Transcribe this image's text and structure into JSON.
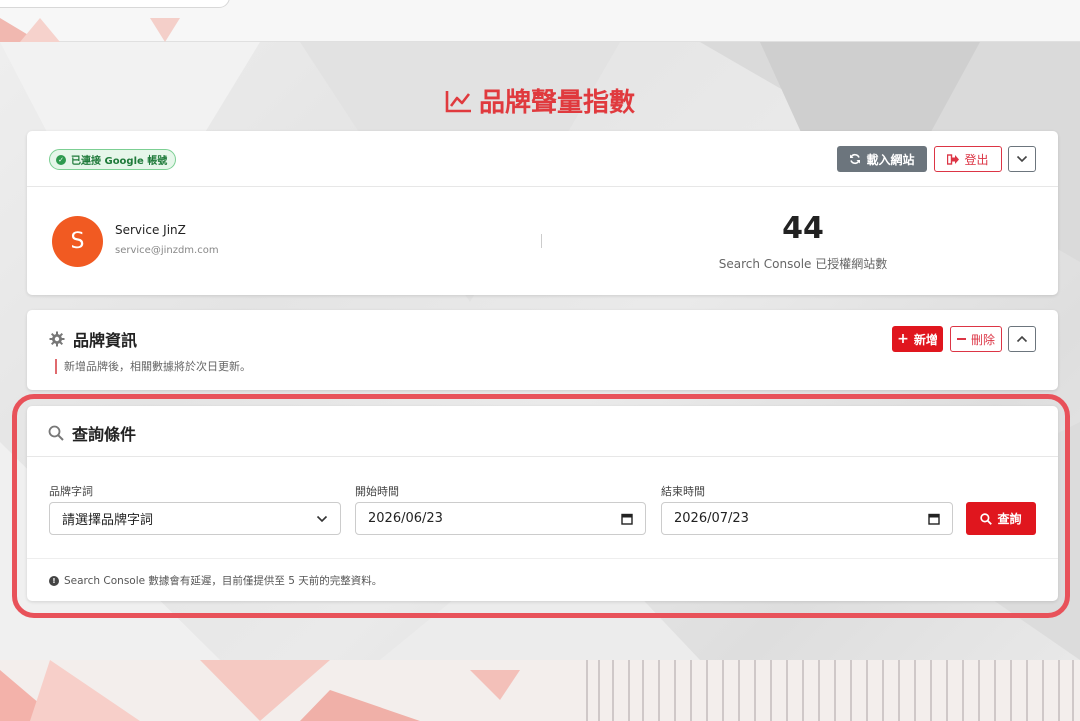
{
  "page": {
    "title": "品牌聲量指數"
  },
  "account": {
    "badge": "已連接 Google 帳號",
    "load_sites_label": "載入網站",
    "logout_label": "登出",
    "user_initial": "S",
    "user_name": "Service JinZ",
    "user_email": "service@jinzdm.com",
    "site_count": "44",
    "site_count_label": "Search Console 已授權網站數"
  },
  "brand_info": {
    "title": "品牌資訊",
    "note": "新增品牌後，相關數據將於次日更新。",
    "add_label": "新增",
    "delete_label": "刪除"
  },
  "query": {
    "title": "查詢條件",
    "brand_label": "品牌字詞",
    "brand_value": "請選擇品牌字詞",
    "start_label": "開始時間",
    "start_value": "2026/06/23",
    "end_label": "結束時間",
    "end_value": "2026/07/23",
    "submit_label": "查詢",
    "footer_note": "Search Console 數據會有延遲，目前僅提供至 5 天前的完整資料。"
  },
  "colors": {
    "accent": "#e0161e",
    "title_red": "#e03a3e",
    "highlight": "#e8525a",
    "avatar": "#f15a22",
    "google_badge_bg": "#e6f6ea"
  }
}
